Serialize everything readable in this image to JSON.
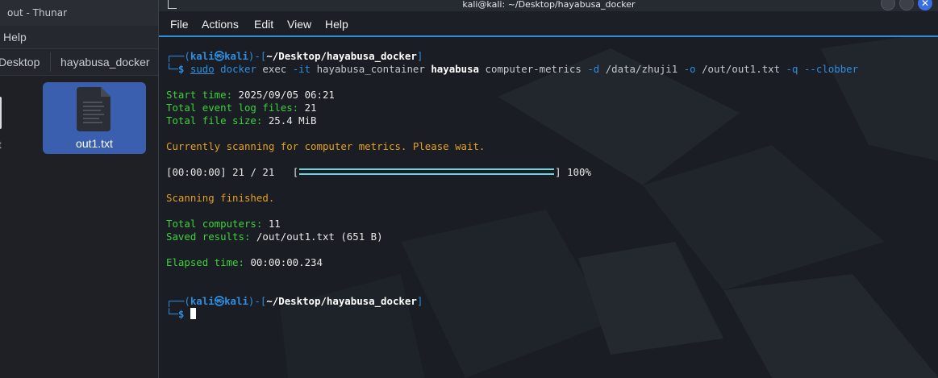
{
  "thunar": {
    "title": "out - Thunar",
    "menu_help": "Help",
    "breadcrumbs": [
      "Desktop",
      "hayabusa_docker"
    ],
    "files": [
      {
        "name": "out1.txt",
        "selected": true
      }
    ],
    "left_file_label_fragment": "t"
  },
  "terminal": {
    "title": "kali@kali: ~/Desktop/hayabusa_docker",
    "menu": [
      "File",
      "Actions",
      "Edit",
      "View",
      "Help"
    ],
    "prompt": {
      "open": "┌──(",
      "user": "kali",
      "at": "㉿",
      "host": "kali",
      "mid": ")-[",
      "path": "~/Desktop/hayabusa_docker",
      "close": "]",
      "second": "└─",
      "dollar": "$"
    },
    "command": {
      "sudo": "sudo",
      "docker": "docker",
      "exec": "exec",
      "it_flag": "-it",
      "container": "hayabusa_container",
      "binary": "hayabusa",
      "subcommand": "computer-metrics",
      "d_flag": "-d",
      "d_value": "/data/zhuji1",
      "o_flag": "-o",
      "o_value": "/out/out1.txt",
      "q_flag": "-q",
      "clobber_flag": "--clobber"
    },
    "output": {
      "start_label": "Start time:",
      "start_value": "2025/09/05 06:21",
      "files_label": "Total event log files:",
      "files_value": "21",
      "size_label": "Total file size:",
      "size_value": "25.4 MiB",
      "scanning_msg": "Currently scanning for computer metrics. Please wait.",
      "progress_time": "[00:00:00]",
      "progress_count": "21 / 21",
      "progress_open": "[",
      "progress_close": "]",
      "progress_percent": "100%",
      "progress_fraction": 1.0,
      "finished_msg": "Scanning finished.",
      "computers_label": "Total computers:",
      "computers_value": "11",
      "saved_label": "Saved results:",
      "saved_value": "/out/out1.txt (651 B)",
      "elapsed_label": "Elapsed time:",
      "elapsed_value": "00:00:00.234"
    }
  },
  "colors": {
    "prompt_blue": "#2e8ee0",
    "output_green": "#3cd23c",
    "message_orange": "#e5a020",
    "progress_cyan": "#6fd3df",
    "selection_blue": "#3a5fae",
    "close_button_blue": "#3b6fe0"
  },
  "icons": {
    "file": "text-file-icon",
    "close": "close-icon",
    "terminal": "terminal-icon"
  }
}
